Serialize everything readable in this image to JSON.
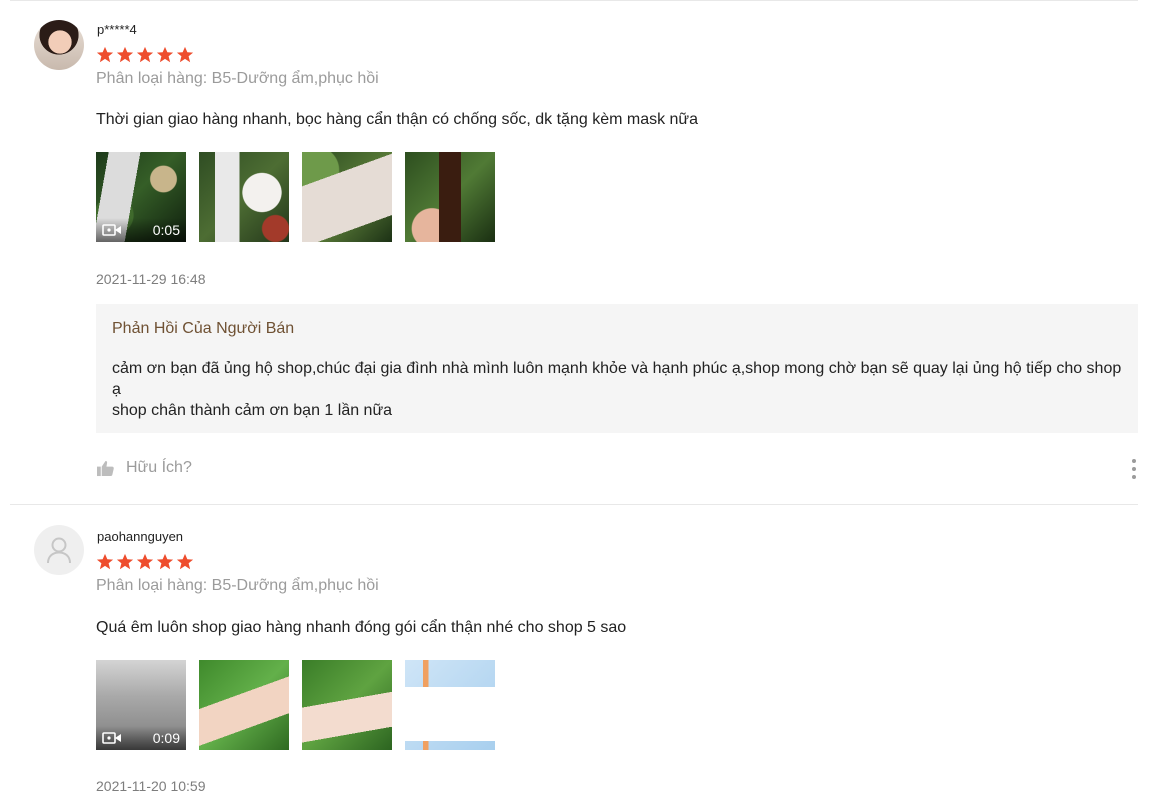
{
  "colors": {
    "star": "#ee4d2d",
    "seller_title": "#6f5133",
    "muted": "#9b9b9b"
  },
  "reviews": [
    {
      "username": "p*****4",
      "rating": 5,
      "variant": "Phân loại hàng: B5-Dưỡng ẩm,phục hồi",
      "comment": "Thời gian giao hàng nhanh, bọc hàng cẩn thận có chống sốc, dk tặng kèm mask nữa",
      "video_duration": "0:05",
      "timestamp": "2021-11-29 16:48",
      "seller_reply": {
        "title": "Phản Hồi Của Người Bán",
        "text": "cảm ơn bạn đã ủng hộ shop,chúc đại gia đình nhà mình luôn mạnh khỏe và hạnh phúc ạ,shop mong chờ bạn sẽ quay lại ủng hộ tiếp cho shop ạ\nshop chân thành cảm ơn bạn 1 lần nữa"
      },
      "helpful_label": "Hữu Ích?",
      "avatar_icon": "user-photo",
      "more_icon": "more-vertical-icon"
    },
    {
      "username": "paohannguyen",
      "rating": 5,
      "variant": "Phân loại hàng: B5-Dưỡng ẩm,phục hồi",
      "comment": "Quá êm luôn shop giao hàng nhanh đóng gói cẩn thận nhé cho shop 5 sao",
      "video_duration": "0:09",
      "timestamp": "2021-11-20 10:59",
      "avatar_icon": "default-user-icon"
    }
  ]
}
